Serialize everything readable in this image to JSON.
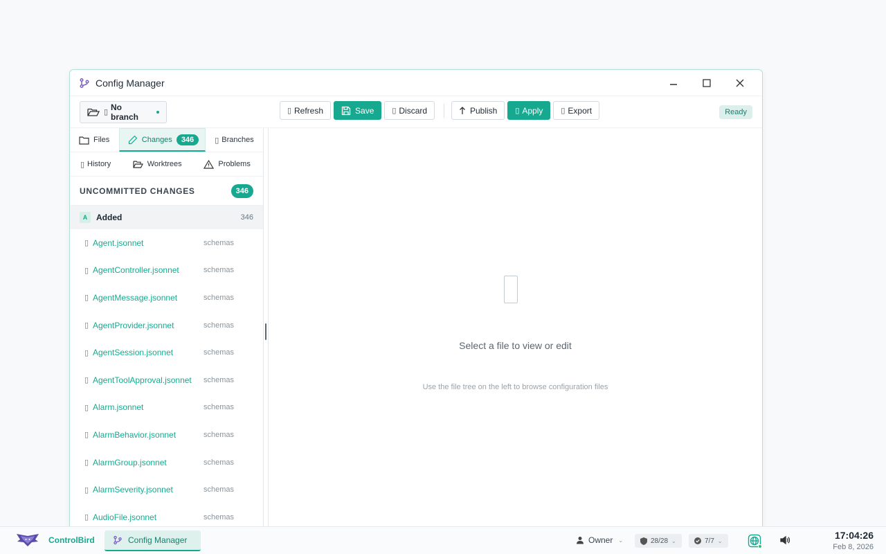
{
  "window": {
    "title": "Config Manager",
    "icon": "git-branch-icon"
  },
  "toolbar": {
    "branch_label": "No branch",
    "refresh_label": "Refresh",
    "save_label": "Save",
    "discard_label": "Discard",
    "publish_label": "Publish",
    "apply_label": "Apply",
    "export_label": "Export",
    "status": "Ready"
  },
  "tabs": {
    "files": "Files",
    "changes": "Changes",
    "changes_count": "346",
    "branches": "Branches",
    "history": "History",
    "worktrees": "Worktrees",
    "problems": "Problems"
  },
  "changes": {
    "header": "UNCOMMITTED CHANGES",
    "total": "346",
    "group": {
      "letter": "A",
      "name": "Added",
      "count": "346"
    },
    "files": [
      {
        "name": "Agent.jsonnet",
        "folder": "schemas"
      },
      {
        "name": "AgentController.jsonnet",
        "folder": "schemas"
      },
      {
        "name": "AgentMessage.jsonnet",
        "folder": "schemas"
      },
      {
        "name": "AgentProvider.jsonnet",
        "folder": "schemas"
      },
      {
        "name": "AgentSession.jsonnet",
        "folder": "schemas"
      },
      {
        "name": "AgentToolApproval.jsonnet",
        "folder": "schemas"
      },
      {
        "name": "Alarm.jsonnet",
        "folder": "schemas"
      },
      {
        "name": "AlarmBehavior.jsonnet",
        "folder": "schemas"
      },
      {
        "name": "AlarmGroup.jsonnet",
        "folder": "schemas"
      },
      {
        "name": "AlarmSeverity.jsonnet",
        "folder": "schemas"
      },
      {
        "name": "AudioFile.jsonnet",
        "folder": "schemas"
      }
    ]
  },
  "main": {
    "empty_title": "Select a file to view or edit",
    "empty_subtitle": "Use the file tree on the left to browse configuration files"
  },
  "taskbar": {
    "brand": "ControlBird",
    "active_app": "Config Manager",
    "user": "Owner",
    "shield_count": "28/28",
    "check_count": "7/7",
    "time": "17:04:26",
    "date": "Feb 8, 2026"
  },
  "colors": {
    "accent": "#17a98f",
    "status_bg": "#dcefea"
  }
}
